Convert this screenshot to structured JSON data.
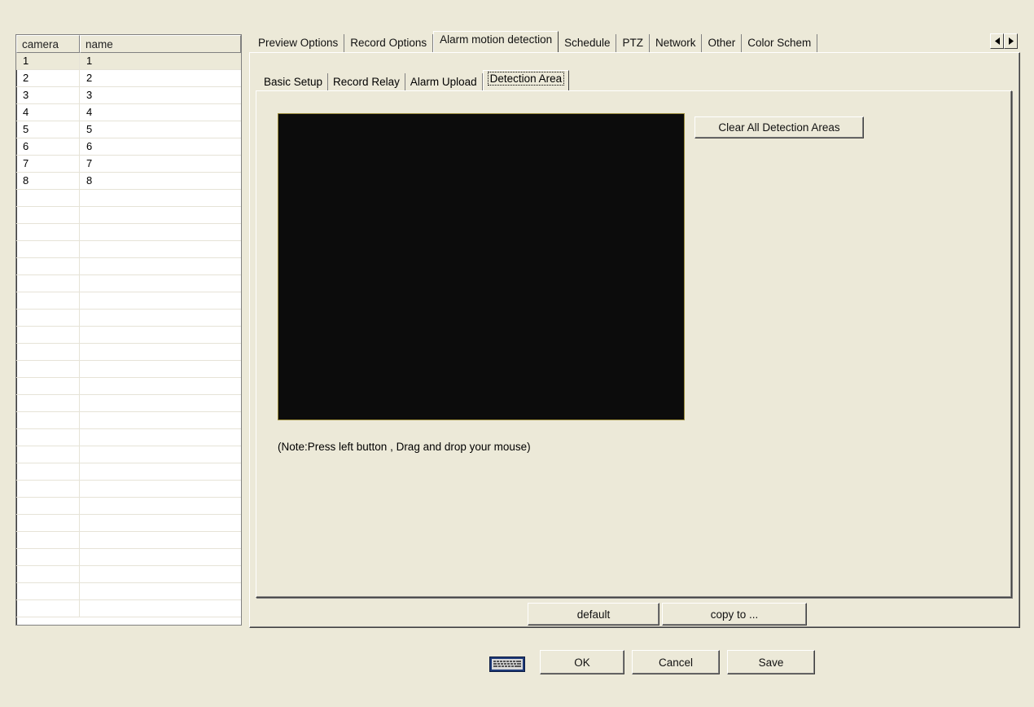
{
  "camera_table": {
    "headers": {
      "camera": "camera",
      "name": "name"
    },
    "rows": [
      {
        "camera": "1",
        "name": "1"
      },
      {
        "camera": "2",
        "name": "2"
      },
      {
        "camera": "3",
        "name": "3"
      },
      {
        "camera": "4",
        "name": "4"
      },
      {
        "camera": "5",
        "name": "5"
      },
      {
        "camera": "6",
        "name": "6"
      },
      {
        "camera": "7",
        "name": "7"
      },
      {
        "camera": "8",
        "name": "8"
      }
    ],
    "selected_index": 0
  },
  "main_tabs": [
    {
      "label": "Preview Options"
    },
    {
      "label": "Record Options"
    },
    {
      "label": "Alarm motion detection",
      "active": true
    },
    {
      "label": "Schedule"
    },
    {
      "label": "PTZ"
    },
    {
      "label": "Network"
    },
    {
      "label": "Other"
    },
    {
      "label": "Color Schem"
    }
  ],
  "sub_tabs": [
    {
      "label": "Basic Setup"
    },
    {
      "label": "Record Relay"
    },
    {
      "label": "Alarm Upload"
    },
    {
      "label": "Detection Area",
      "active": true
    }
  ],
  "detection": {
    "clear_button": "Clear All Detection Areas",
    "note": "(Note:Press left button , Drag and drop your mouse)"
  },
  "panel_buttons": {
    "default": "default",
    "copy_to": "copy to ..."
  },
  "dialog_buttons": {
    "ok": "OK",
    "cancel": "Cancel",
    "save": "Save"
  },
  "icons": {
    "tab_left": "arrow-left-icon",
    "tab_right": "arrow-right-icon",
    "keyboard": "keyboard-icon"
  }
}
